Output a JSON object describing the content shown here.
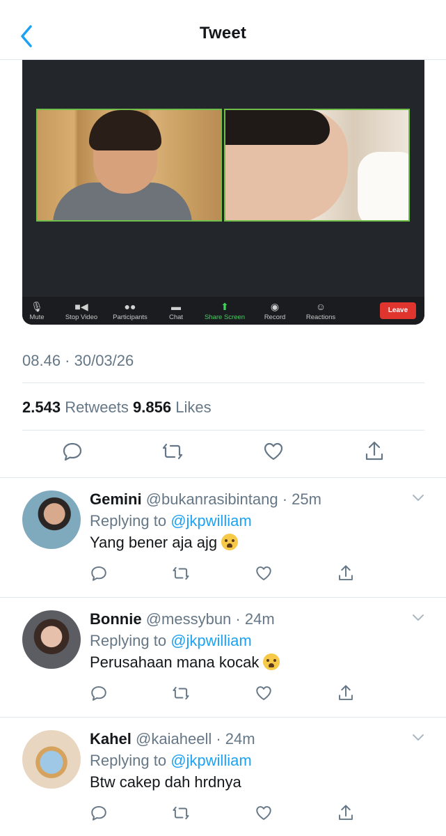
{
  "header": {
    "title": "Tweet",
    "back_icon": "chevron-left-icon"
  },
  "media": {
    "toolbar": {
      "items": [
        {
          "label": "Mute",
          "icon": "microphone-icon"
        },
        {
          "label": "Stop Video",
          "icon": "video-camera-icon"
        },
        {
          "label": "Participants",
          "icon": "participants-icon"
        },
        {
          "label": "Chat",
          "icon": "chat-bubble-icon"
        },
        {
          "label": "Share Screen",
          "icon": "share-screen-icon"
        },
        {
          "label": "Record",
          "icon": "record-icon"
        },
        {
          "label": "Reactions",
          "icon": "reactions-icon"
        }
      ],
      "leave_label": "Leave"
    }
  },
  "tweet": {
    "timestamp": "08.46 · 30/03/26",
    "retweets_count": "2.543",
    "retweets_label": "Retweets",
    "likes_count": "9.856",
    "likes_label": "Likes"
  },
  "colors": {
    "accent": "#1da1f2",
    "secondary_text": "#657786",
    "leave": "#e0352f",
    "share": "#3fd45c"
  },
  "replies": [
    {
      "name": "Gemini",
      "handle": "@bukanrasibintang",
      "time": "25m",
      "replying_prefix": "Replying to",
      "mention": "@jkpwilliam",
      "text": "Yang bener aja ajg",
      "has_emoji": true
    },
    {
      "name": "Bonnie",
      "handle": "@messybun",
      "time": "24m",
      "replying_prefix": "Replying to",
      "mention": "@jkpwilliam",
      "text": "Perusahaan mana kocak",
      "has_emoji": true
    },
    {
      "name": "Kahel",
      "handle": "@kaiaheell",
      "time": "24m",
      "replying_prefix": "Replying to",
      "mention": "@jkpwilliam",
      "text": "Btw cakep dah hrdnya",
      "has_emoji": false
    }
  ]
}
